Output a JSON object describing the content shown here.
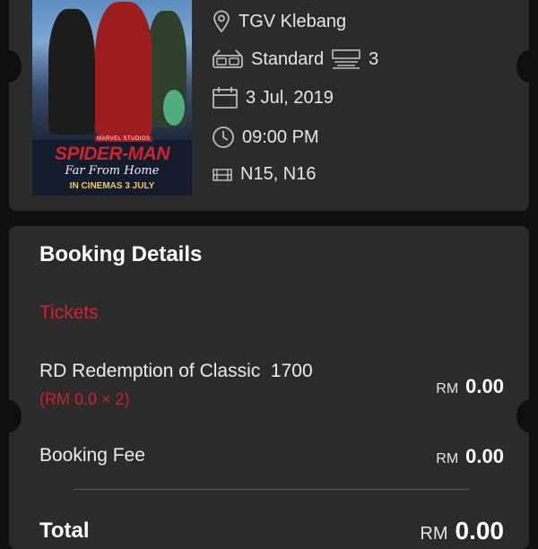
{
  "movie": {
    "poster_studio": "MARVEL STUDIOS",
    "poster_title": "SPIDER-MAN",
    "poster_subtitle": "Far From Home",
    "poster_release": "IN CINEMAS 3 JULY"
  },
  "showtime": {
    "cinema": "TGV Klebang",
    "experience": "Standard",
    "hall": "3",
    "date": "3 Jul, 2019",
    "time": "09:00 PM",
    "seats": "N15, N16"
  },
  "booking": {
    "title": "Booking Details",
    "tickets_label": "Tickets",
    "ticket_name": "RD Redemption of Classic  1700",
    "ticket_qty": "(RM 0.0 × 2)",
    "ticket_currency": "RM",
    "ticket_amount": "0.00",
    "fee_label": "Booking Fee",
    "fee_currency": "RM",
    "fee_amount": "0.00",
    "total_label": "Total",
    "total_currency": "RM",
    "total_amount": "0.00"
  },
  "colors": {
    "background": "#0f0f0f",
    "card": "#2b2b2b",
    "accent_red": "#d0232d",
    "text": "#ececec"
  },
  "icons": [
    "location-pin-icon",
    "3d-glasses-icon",
    "cinema-hall-icon",
    "calendar-icon",
    "clock-icon",
    "seat-icon"
  ]
}
